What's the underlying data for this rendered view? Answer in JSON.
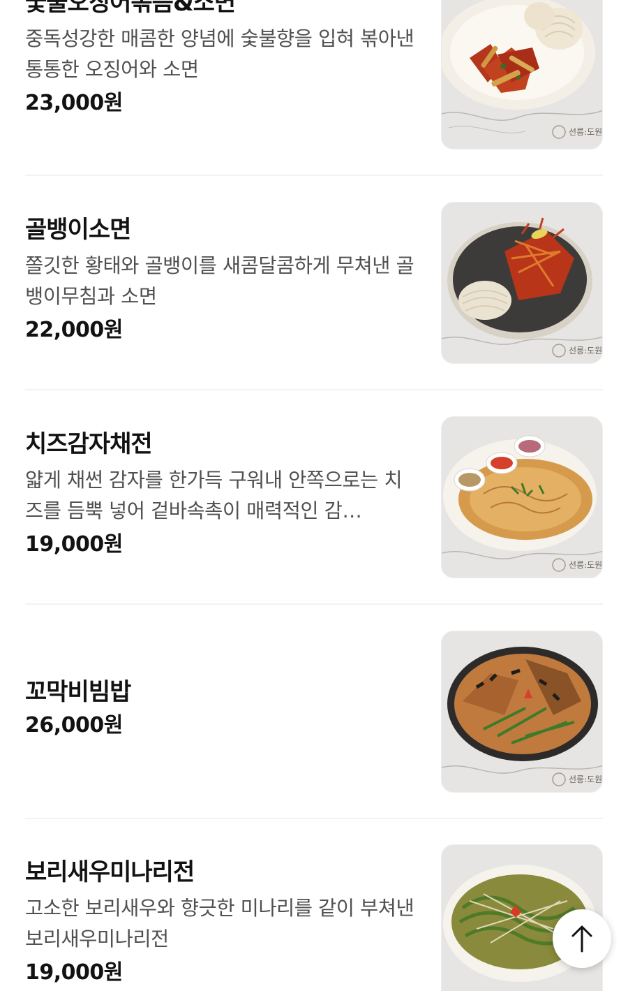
{
  "menu": {
    "items": [
      {
        "name": "숯불오징어볶음&소면",
        "description": "중독성강한 매콤한 양념에 숯불향을 입혀 볶아낸 통통한 오징어와 소면",
        "price": "23,000원",
        "photo_icon": "spicy-squid-dish-icon",
        "photo_brand": "선릉:도원"
      },
      {
        "name": "골뱅이소면",
        "description": "쫄깃한 황태와 골뱅이를 새콤달콤하게 무쳐낸 골뱅이무침과 소면",
        "price": "22,000원",
        "photo_icon": "whelk-noodle-dish-icon",
        "photo_brand": "선릉:도원"
      },
      {
        "name": "치즈감자채전",
        "description": "얇게 채썬 감자를 한가득 구워내 안쪽으로는 치즈를 듬뿍 넣어 겉바속촉이 매력적인 감…",
        "price": "19,000원",
        "photo_icon": "potato-pancake-dish-icon",
        "photo_brand": "선릉:도원"
      },
      {
        "name": "꼬막비빔밥",
        "description": "",
        "price": "26,000원",
        "photo_icon": "cockle-bibimbap-dish-icon",
        "photo_brand": "선릉:도원"
      },
      {
        "name": "보리새우미나리전",
        "description": "고소한 보리새우와 향긋한 미나리를 같이 부쳐낸 보리새우미나리전",
        "price": "19,000원",
        "photo_icon": "shrimp-minari-pancake-dish-icon",
        "photo_brand": ""
      }
    ]
  },
  "scroll_top_button": {
    "icon": "arrow-up-icon"
  },
  "colors": {
    "text_primary": "#121212",
    "text_secondary": "#505050",
    "divider": "#f2f2f2",
    "photo_background": "#e7e6e4"
  }
}
